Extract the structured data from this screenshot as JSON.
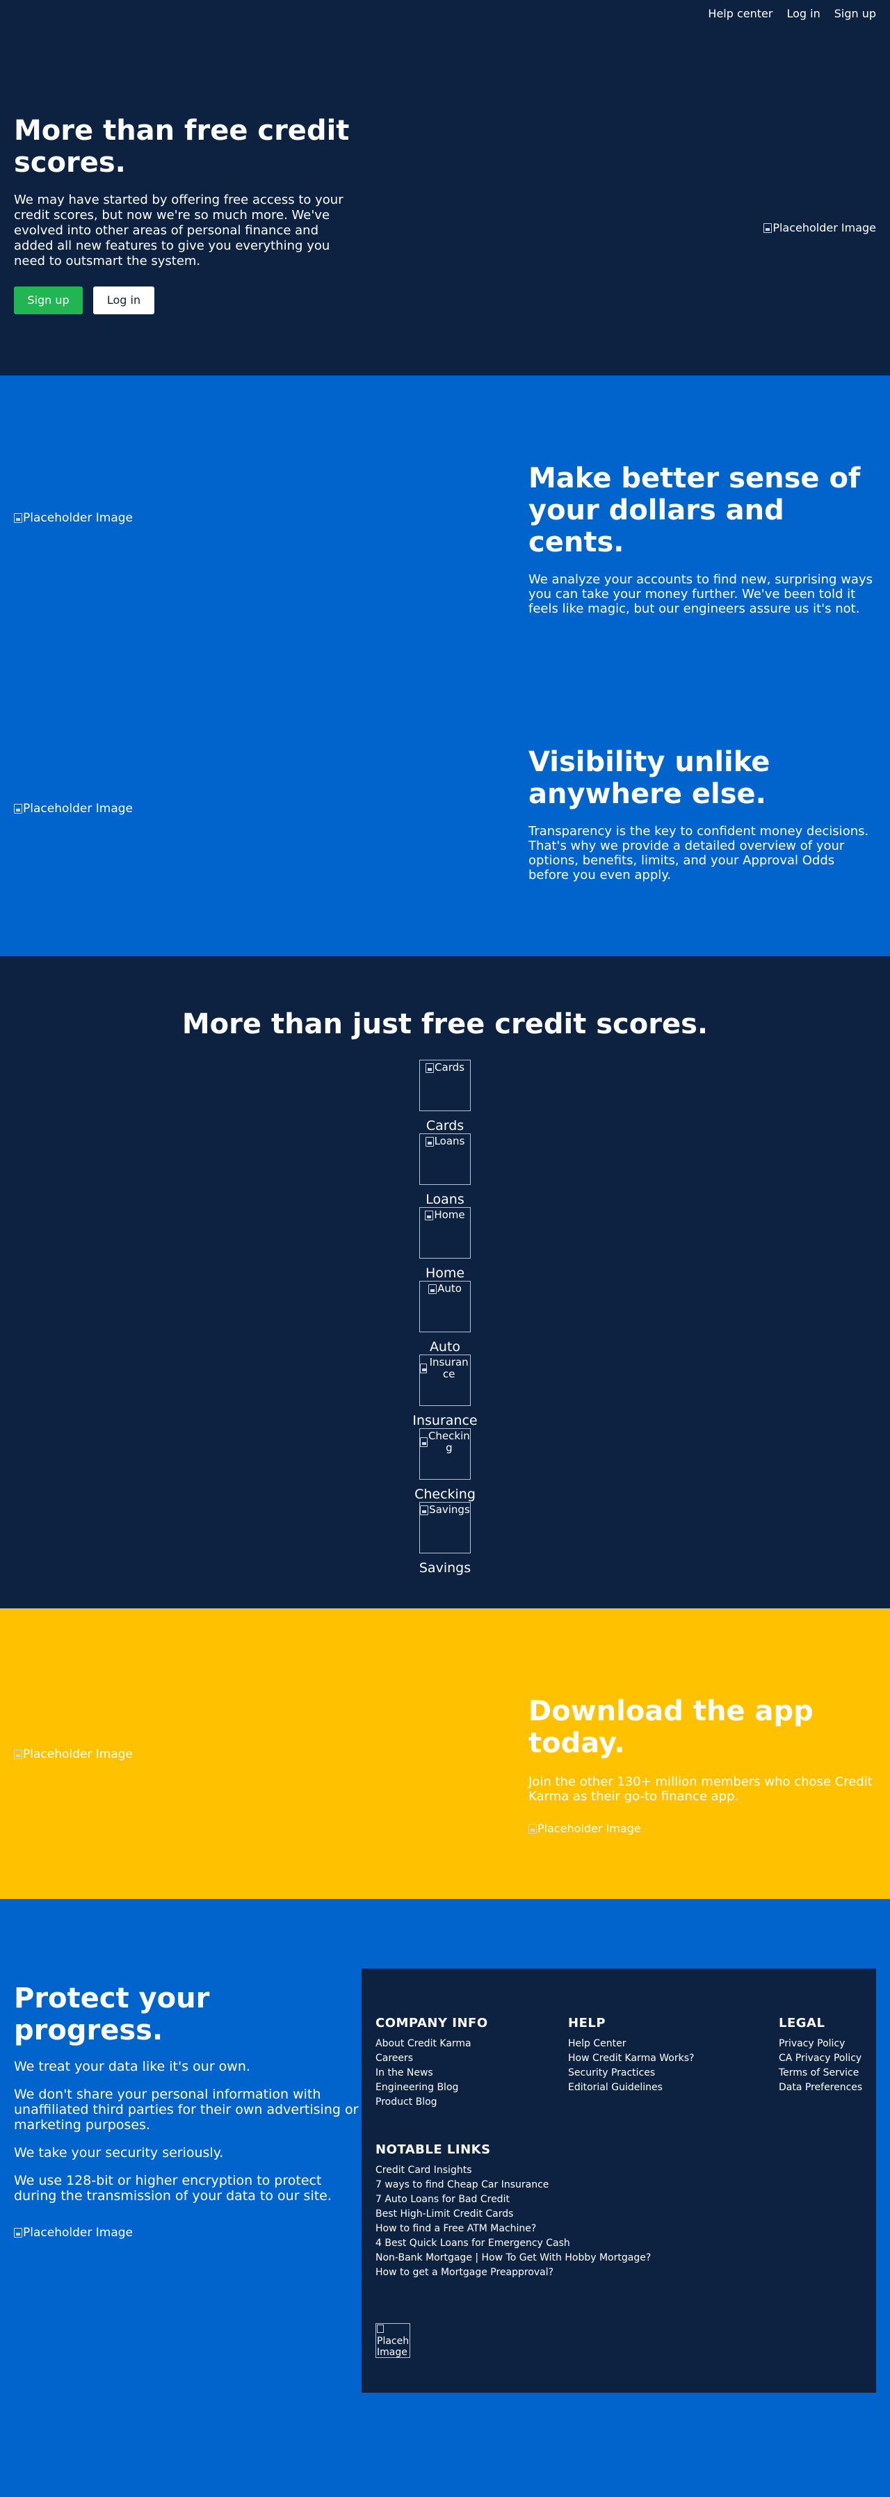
{
  "nav": {
    "help_center": "Help center",
    "log_in": "Log in",
    "sign_up": "Sign up"
  },
  "hero": {
    "title": "More than free credit scores.",
    "body": "We may have started by offering free access to your credit scores, but now we're so much more. We've evolved into other areas of personal finance and added all new features to give you everything you need to outsmart the system.",
    "signup_label": "Sign up",
    "login_label": "Log in",
    "image_alt": "Placeholder Image"
  },
  "features": [
    {
      "title": "Make better sense of your dollars and cents.",
      "body": "We analyze your accounts to find new, surprising ways you can take your money further. We've been told it feels like magic, but our engineers assure us it's not.",
      "image_alt": "Placeholder Image"
    },
    {
      "title": "Visibility unlike anywhere else.",
      "body": "Transparency is the key to confident money decisions. That's why we provide a detailed overview of your options, benefits, limits, and your Approval Odds before you even apply.",
      "image_alt": "Placeholder Image"
    }
  ],
  "products": {
    "title": "More than just free credit scores.",
    "items": [
      {
        "alt": "Cards",
        "label": "Cards"
      },
      {
        "alt": "Loans",
        "label": "Loans"
      },
      {
        "alt": "Home",
        "label": "Home"
      },
      {
        "alt": "Auto",
        "label": "Auto"
      },
      {
        "alt": "Insurance",
        "label": "Insurance"
      },
      {
        "alt": "Checking",
        "label": "Checking"
      },
      {
        "alt": "Savings",
        "label": "Savings"
      }
    ]
  },
  "download": {
    "title": "Download the app today.",
    "body": "Join the other 130+ million members who chose Credit Karma as their go-to finance app.",
    "image_alt": "Placeholder Image",
    "badge_alt": "Placeholder Image"
  },
  "protect": {
    "title": "Protect your progress.",
    "paragraphs": [
      "We treat your data like it's our own.",
      "We don't share your personal information with unaffiliated third parties for their own advertising or marketing purposes.",
      "We take your security seriously.",
      "We use 128-bit or higher encryption to protect during the transmission of your data to our site."
    ],
    "image_alt": "Placeholder Image"
  },
  "footer": {
    "company": {
      "title": "COMPANY INFO",
      "links": [
        "About Credit Karma",
        "Careers",
        "In the News",
        "Engineering Blog",
        "Product Blog"
      ]
    },
    "help": {
      "title": "HELP",
      "links": [
        "Help Center",
        "How Credit Karma Works?",
        "Security Practices",
        "Editorial Guidelines"
      ]
    },
    "legal": {
      "title": "LEGAL",
      "links": [
        "Privacy Policy",
        "CA Privacy Policy",
        "Terms of Service",
        "Data Preferences"
      ]
    },
    "notable": {
      "title": "NOTABLE LINKS",
      "links": [
        "Credit Card Insights",
        "7 ways to find Cheap Car Insurance",
        "7 Auto Loans for Bad Credit",
        "Best High-Limit Credit Cards",
        "How to find a Free ATM Machine?",
        "4 Best Quick Loans for Emergency Cash",
        "Non-Bank Mortgage | How To Get With Hobby Mortgage?",
        "How to get a Mortgage Preapproval?"
      ]
    },
    "logo_alt": "Placeholder Image"
  },
  "colors": {
    "navy": "#0d2240",
    "blue": "#0064cc",
    "yellow": "#ffc100",
    "green": "#21b554"
  }
}
